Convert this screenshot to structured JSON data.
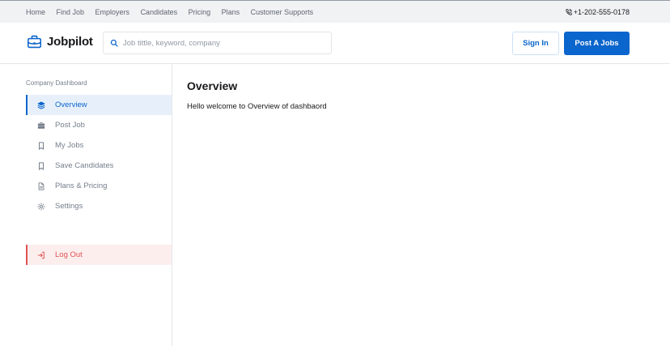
{
  "topbar": {
    "nav": [
      "Home",
      "Find Job",
      "Employers",
      "Candidates",
      "Pricing",
      "Plans",
      "Customer Supports"
    ],
    "phone": "+1-202-555-0178"
  },
  "header": {
    "brand": "Jobpilot",
    "search_placeholder": "Job tittle, keyword, company",
    "search_value": "",
    "signin_label": "Sign In",
    "post_label": "Post A Jobs"
  },
  "sidebar": {
    "heading": "Company Dashboard",
    "items": [
      {
        "label": "Overview",
        "icon": "layers-icon",
        "active": true
      },
      {
        "label": "Post Job",
        "icon": "briefcase-icon",
        "active": false
      },
      {
        "label": "My Jobs",
        "icon": "bookmark-icon",
        "active": false
      },
      {
        "label": "Save Candidates",
        "icon": "bookmark-icon",
        "active": false
      },
      {
        "label": "Plans & Pricing",
        "icon": "document-icon",
        "active": false
      },
      {
        "label": "Settings",
        "icon": "gear-icon",
        "active": false
      }
    ],
    "logout_label": "Log Out"
  },
  "main": {
    "title": "Overview",
    "text": "Hello welcome to Overview of dashbaord"
  },
  "colors": {
    "primary": "#0a65cc",
    "active_bg": "#e7f0fa",
    "danger": "#e05151",
    "danger_bg": "#fdeeee",
    "topbar_bg": "#f1f2f4"
  }
}
